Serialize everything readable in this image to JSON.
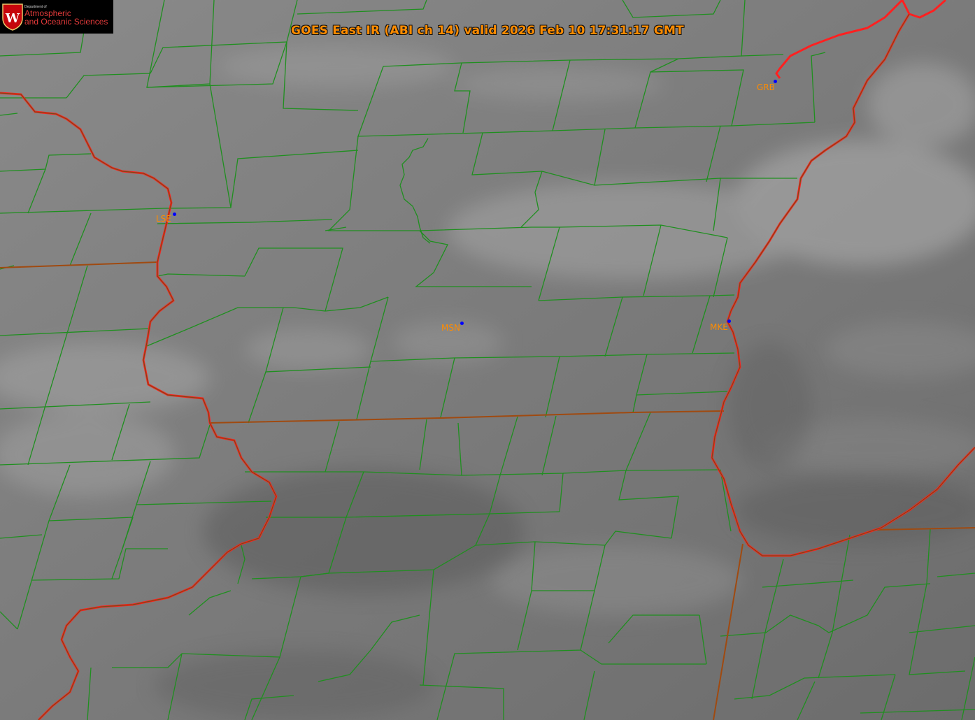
{
  "title": "GOES East IR (ABI ch 14) valid 2026 Feb 10 17:31:17 GMT",
  "logo": {
    "department": "Department of",
    "line1": "Atmospheric",
    "line2": "and Oceanic Sciences",
    "emblem_letter": "W"
  },
  "colors": {
    "title": "#ff8c00",
    "county_lines": "#1f8f1f",
    "state_lines": "#a04a10",
    "river_lines": "#ff2020",
    "station_dot": "#0000ff",
    "station_label": "#ff8c00",
    "logo_red": "#c5050c"
  },
  "stations": [
    {
      "id": "lse",
      "label": "LSE"
    },
    {
      "id": "msn",
      "label": "MSN"
    },
    {
      "id": "mke",
      "label": "MKE"
    },
    {
      "id": "grb",
      "label": "GRB"
    }
  ]
}
